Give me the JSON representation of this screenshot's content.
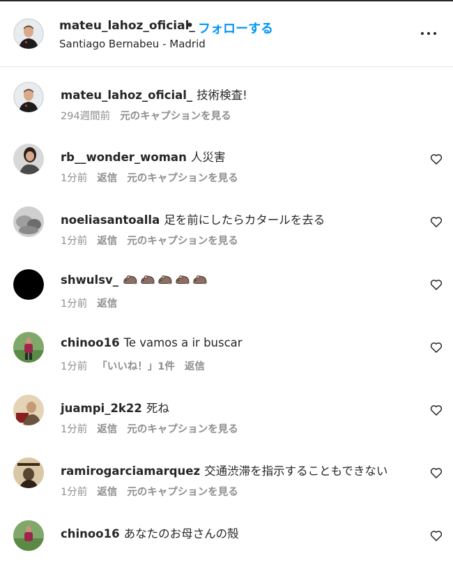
{
  "header": {
    "username": "mateu_lahoz_oficial_",
    "dot": "•",
    "follow_label": "フォローする",
    "location": "Santiago Bernabeu - Madrid"
  },
  "comments": [
    {
      "user": "mateu_lahoz_oficial_",
      "text": "技術検査!",
      "time": "294週間前",
      "actions": [
        "元のキャプションを見る"
      ]
    },
    {
      "user": "rb__wonder_woman",
      "text": "人災害",
      "time": "1分前",
      "actions": [
        "返信",
        "元のキャプションを見る"
      ]
    },
    {
      "user": "noeliasantoalla",
      "text": "足を前にしたらカタールを去る",
      "time": "1分前",
      "actions": [
        "返信",
        "元のキャプションを見る"
      ]
    },
    {
      "user": "shwulsv_",
      "text": "",
      "time": "1分前",
      "actions": [
        "返信"
      ],
      "emoji_count": 5,
      "emoji": "rat-emoji"
    },
    {
      "user": "chinoo16",
      "text": "Te vamos a ir buscar",
      "time": "1分前",
      "actions": [
        "「いいね！」1件",
        "返信"
      ]
    },
    {
      "user": "juampi_2k22",
      "text": "死ね",
      "time": "1分前",
      "actions": [
        "返信",
        "元のキャプションを見る"
      ]
    },
    {
      "user": "ramirogarciamarquez",
      "text": "交通渋滞を指示することもできない",
      "time": "1分前",
      "actions": [
        "返信",
        "元のキャプションを見る"
      ]
    },
    {
      "user": "chinoo16",
      "text": "あなたのお母さんの殻",
      "time": "",
      "actions": []
    }
  ],
  "colors": {
    "accent": "#0095f6",
    "text": "#262626",
    "muted": "#8e8e8e",
    "divider": "#e6e6e6"
  },
  "icons": {
    "more": "more-options-icon",
    "like": "heart-outline-icon"
  }
}
